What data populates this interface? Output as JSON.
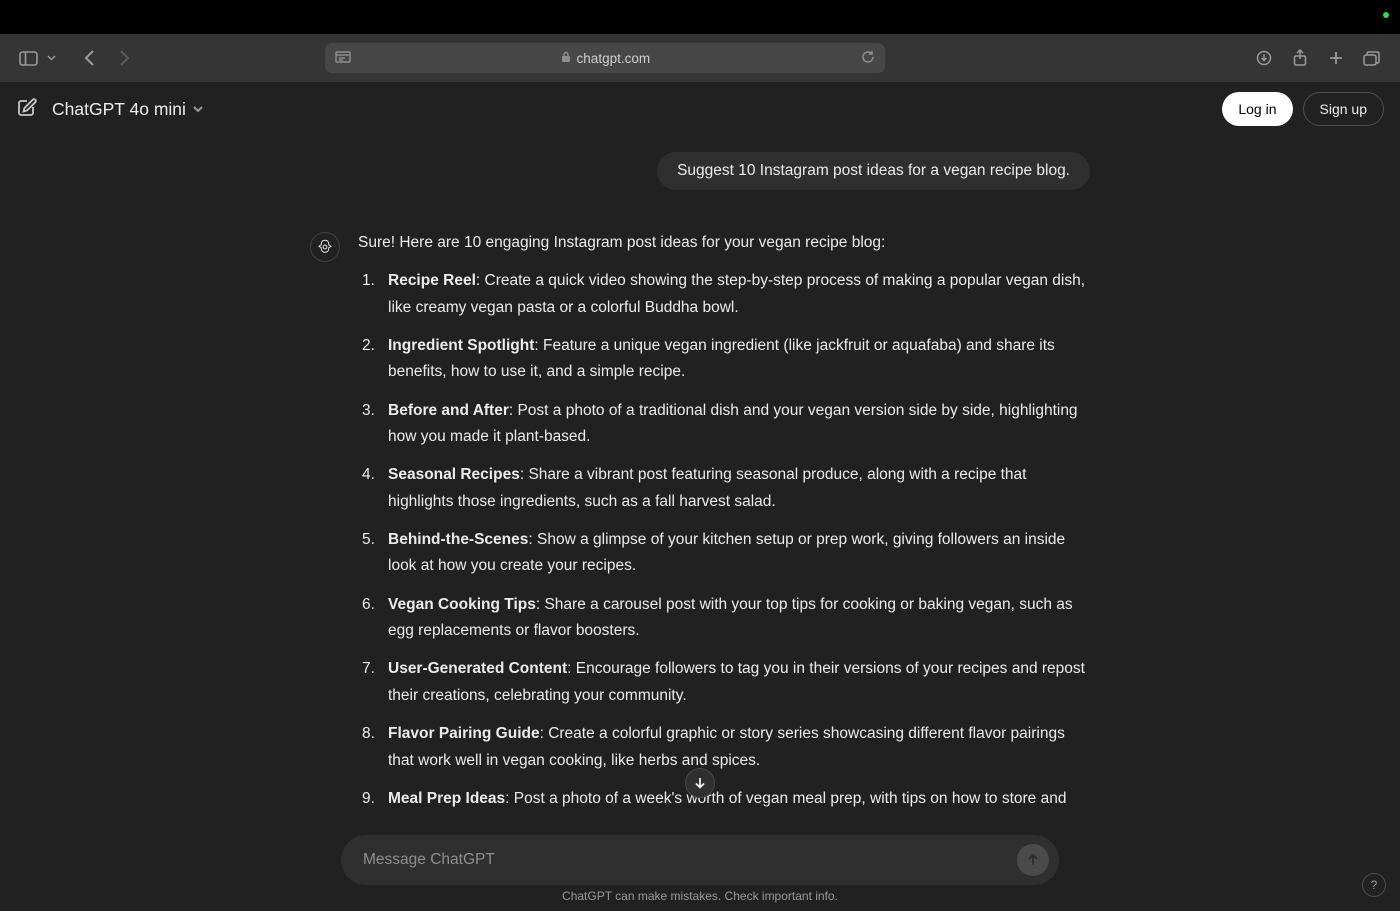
{
  "browser": {
    "url": "chatgpt.com"
  },
  "header": {
    "model": "ChatGPT 4o mini",
    "login": "Log in",
    "signup": "Sign up"
  },
  "conversation": {
    "user_message": "Suggest 10 Instagram post ideas for a vegan recipe blog.",
    "assistant_intro": "Sure! Here are 10 engaging Instagram post ideas for your vegan recipe blog:",
    "ideas": [
      {
        "title": "Recipe Reel",
        "text": ": Create a quick video showing the step-by-step process of making a popular vegan dish, like creamy vegan pasta or a colorful Buddha bowl."
      },
      {
        "title": "Ingredient Spotlight",
        "text": ": Feature a unique vegan ingredient (like jackfruit or aquafaba) and share its benefits, how to use it, and a simple recipe."
      },
      {
        "title": "Before and After",
        "text": ": Post a photo of a traditional dish and your vegan version side by side, highlighting how you made it plant-based."
      },
      {
        "title": "Seasonal Recipes",
        "text": ": Share a vibrant post featuring seasonal produce, along with a recipe that highlights those ingredients, such as a fall harvest salad."
      },
      {
        "title": "Behind-the-Scenes",
        "text": ": Show a glimpse of your kitchen setup or prep work, giving followers an inside look at how you create your recipes."
      },
      {
        "title": "Vegan Cooking Tips",
        "text": ": Share a carousel post with your top tips for cooking or baking vegan, such as egg replacements or flavor boosters."
      },
      {
        "title": "User-Generated Content",
        "text": ": Encourage followers to tag you in their versions of your recipes and repost their creations, celebrating your community."
      },
      {
        "title": "Flavor Pairing Guide",
        "text": ": Create a colorful graphic or story series showcasing different flavor pairings that work well in vegan cooking, like herbs and spices."
      },
      {
        "title": "Meal Prep Ideas",
        "text": ": Post a photo of a week's worth of vegan meal prep, with tips on how to store and reheat them for busy weekda"
      }
    ]
  },
  "compose": {
    "placeholder": "Message ChatGPT"
  },
  "footer": {
    "disclaimer": "ChatGPT can make mistakes. Check important info.",
    "help": "?"
  }
}
